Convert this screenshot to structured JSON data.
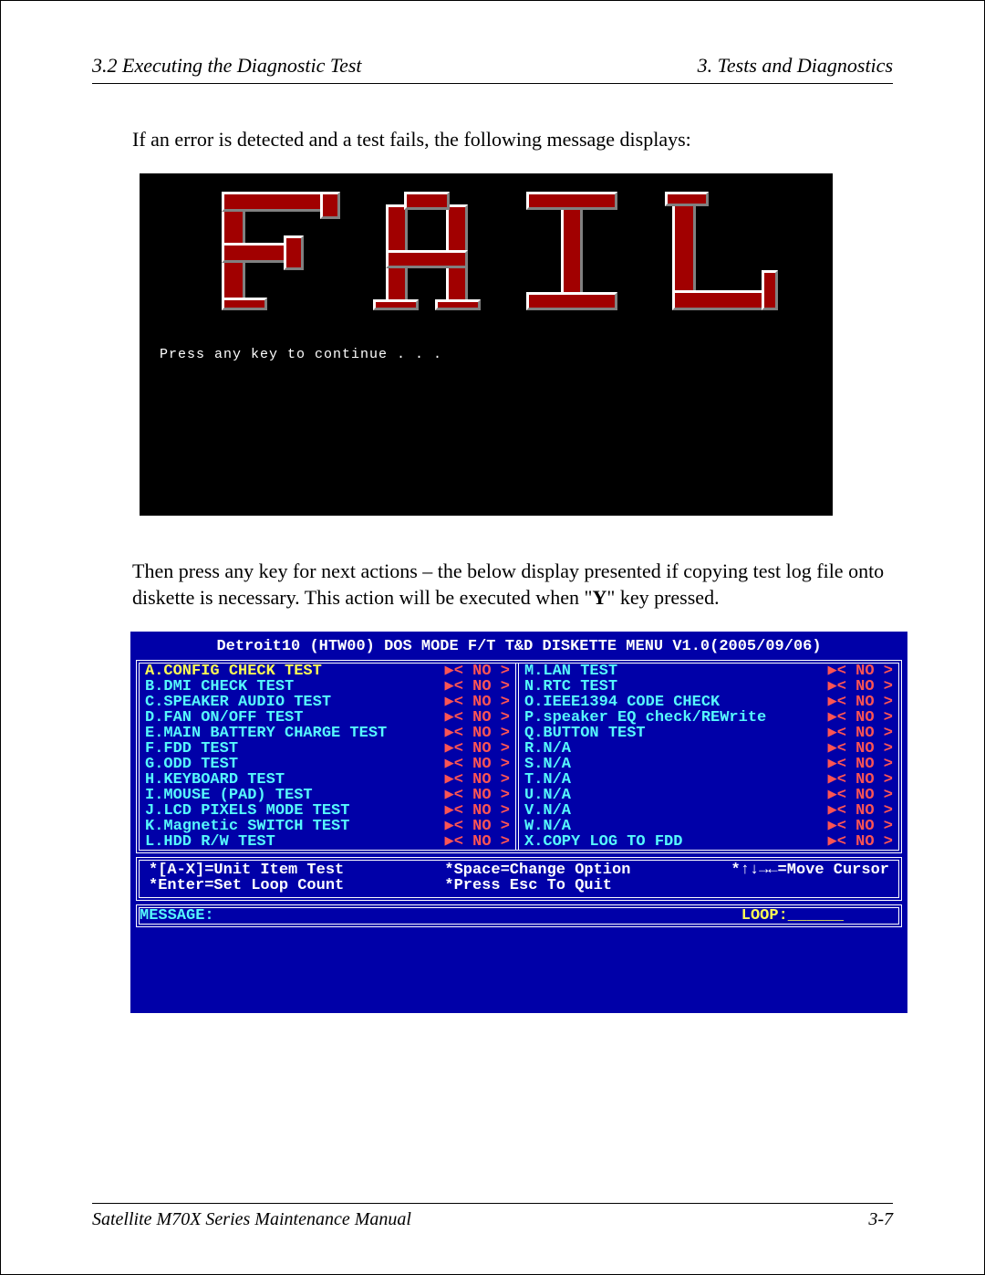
{
  "header": {
    "left": "3.2 Executing the Diagnostic Test",
    "right": "3.  Tests and Diagnostics"
  },
  "para1": "If an error is detected and a test fails, the following message displays:",
  "fail_prompt": "Press any key to continue . . .",
  "para2_a": "Then press any key for next actions – the below display presented if copying test log file onto diskette is necessary. This action will be executed when \"",
  "para2_bold": "Y",
  "para2_b": "\" key pressed.",
  "dos": {
    "title": "Detroit10 (HTW00) DOS MODE F/T T&D DISKETTE MENU V1.0(2005/09/06)",
    "left": [
      {
        "label": "A.CONFIG CHECK TEST",
        "val": "▶< NO >",
        "sel": true
      },
      {
        "label": "B.DMI CHECK TEST",
        "val": "▶< NO >"
      },
      {
        "label": "C.SPEAKER AUDIO TEST",
        "val": "▶< NO >"
      },
      {
        "label": "D.FAN ON/OFF TEST",
        "val": "▶< NO >"
      },
      {
        "label": "E.MAIN BATTERY CHARGE TEST",
        "val": "▶< NO >"
      },
      {
        "label": "F.FDD TEST",
        "val": "▶< NO >"
      },
      {
        "label": "G.ODD TEST",
        "val": "▶< NO >"
      },
      {
        "label": "H.KEYBOARD TEST",
        "val": "▶< NO >"
      },
      {
        "label": "I.MOUSE (PAD) TEST",
        "val": "▶< NO >"
      },
      {
        "label": "J.LCD PIXELS MODE TEST",
        "val": "▶< NO >"
      },
      {
        "label": "K.Magnetic SWITCH TEST",
        "val": "▶< NO >"
      },
      {
        "label": "L.HDD R/W TEST",
        "val": "▶< NO >"
      }
    ],
    "right": [
      {
        "label": "M.LAN TEST",
        "val": "▶< NO >"
      },
      {
        "label": "N.RTC TEST",
        "val": "▶< NO >"
      },
      {
        "label": "O.IEEE1394 CODE CHECK",
        "val": "▶< NO >"
      },
      {
        "label": "P.speaker EQ check/REWrite",
        "val": "▶< NO >"
      },
      {
        "label": "Q.BUTTON TEST",
        "val": "▶< NO >"
      },
      {
        "label": "R.N/A",
        "val": "▶< NO >"
      },
      {
        "label": "S.N/A",
        "val": "▶< NO >"
      },
      {
        "label": "T.N/A",
        "val": "▶< NO >"
      },
      {
        "label": "U.N/A",
        "val": "▶< NO >"
      },
      {
        "label": "V.N/A",
        "val": "▶< NO >"
      },
      {
        "label": "W.N/A",
        "val": "▶< NO >"
      },
      {
        "label": "X.COPY LOG TO FDD",
        "val": "▶< NO >"
      }
    ],
    "hints": {
      "c1a": "*[A-X]=Unit Item Test",
      "c1b": "*Enter=Set Loop Count",
      "c2a": "*Space=Change Option",
      "c2b": "*Press Esc To Quit",
      "c3": "*↑↓→←=Move Cursor"
    },
    "message_label": "MESSAGE:",
    "loop_label": "LOOP:______"
  },
  "footer": {
    "left": "Satellite M70X Series Maintenance Manual",
    "right": "3-7"
  }
}
